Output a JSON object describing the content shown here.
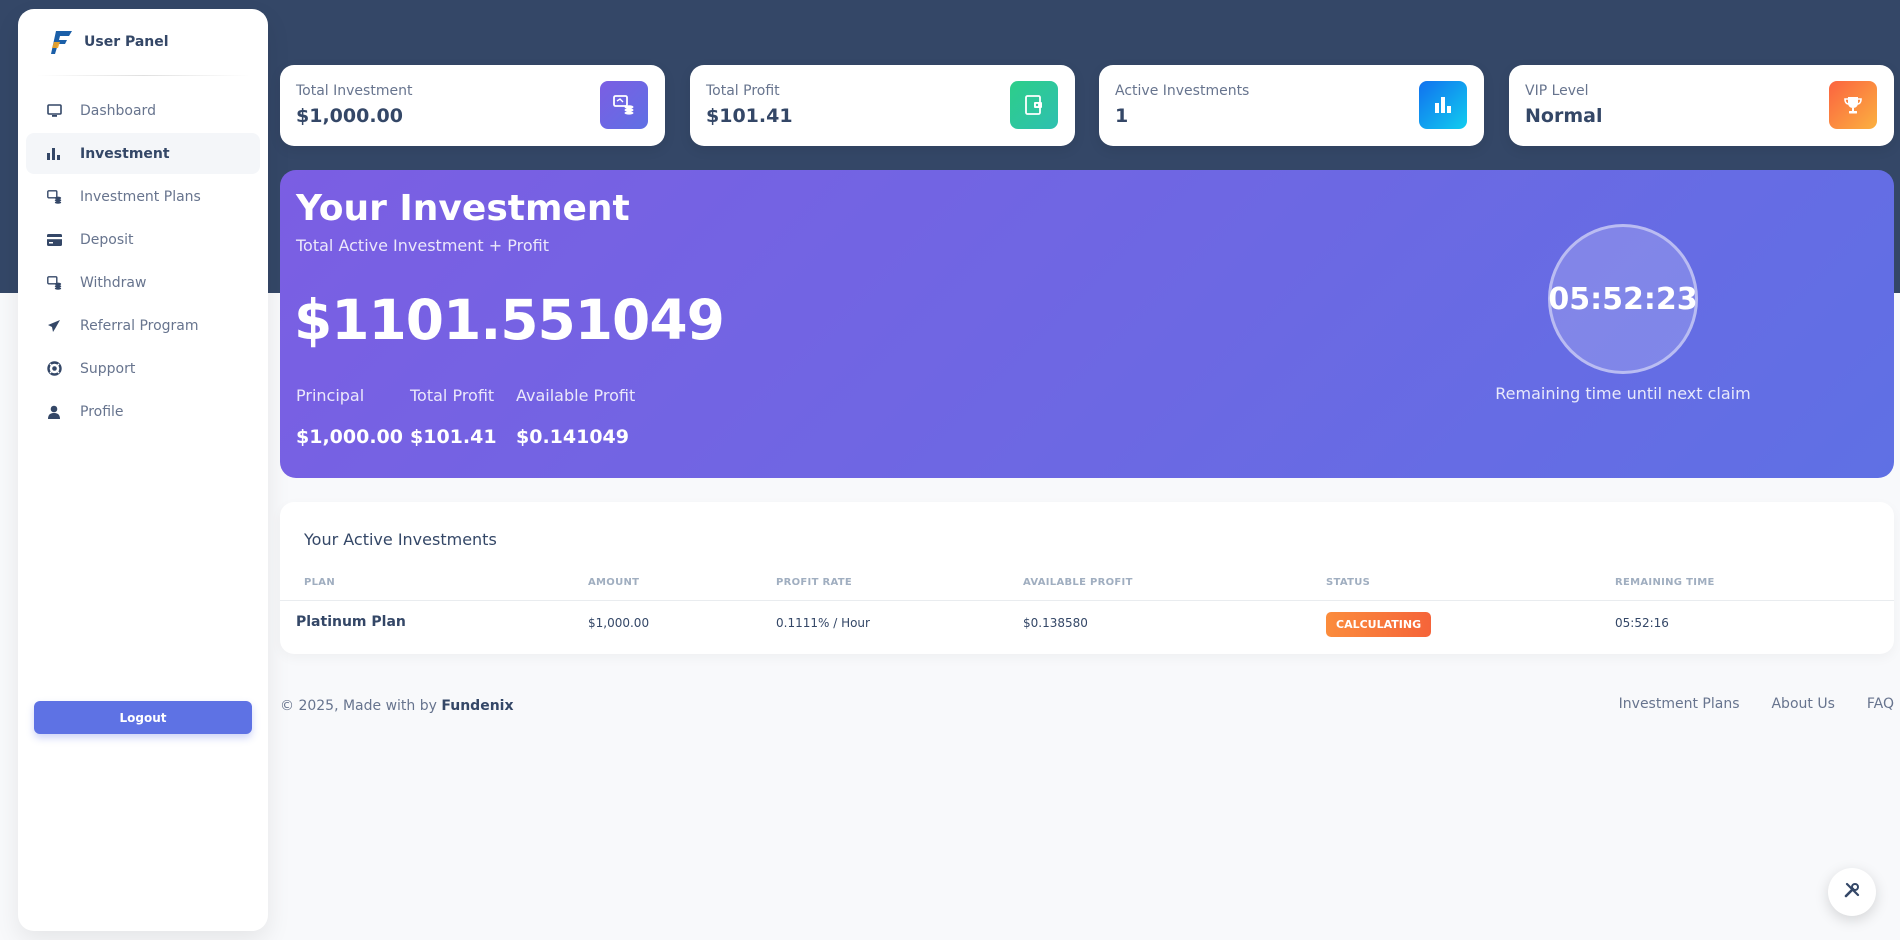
{
  "brand": {
    "name": "User Panel"
  },
  "sidebar": {
    "items": [
      {
        "label": "Dashboard",
        "icon": "monitor-icon"
      },
      {
        "label": "Investment",
        "icon": "bar-chart-icon",
        "active": true
      },
      {
        "label": "Investment Plans",
        "icon": "coins-icon"
      },
      {
        "label": "Deposit",
        "icon": "credit-card-icon"
      },
      {
        "label": "Withdraw",
        "icon": "coins-icon"
      },
      {
        "label": "Referral Program",
        "icon": "paper-plane-icon"
      },
      {
        "label": "Support",
        "icon": "lifebuoy-icon"
      },
      {
        "label": "Profile",
        "icon": "user-icon"
      }
    ],
    "logout_label": "Logout"
  },
  "stats": [
    {
      "label": "Total Investment",
      "value": "$1,000.00",
      "icon": "coins-icon",
      "color": "#6a5ce0"
    },
    {
      "label": "Total Profit",
      "value": "$101.41",
      "icon": "wallet-icon",
      "color": "#2ec7a1"
    },
    {
      "label": "Active Investments",
      "value": "1",
      "icon": "bar-chart-icon",
      "color": "#1a9cf2"
    },
    {
      "label": "VIP Level",
      "value": "Normal",
      "icon": "trophy-icon",
      "color": "#fb8c3c"
    }
  ],
  "hero": {
    "title": "Your Investment",
    "subtitle": "Total Active Investment + Profit",
    "total": "$1101.551049",
    "principal_label": "Principal",
    "principal_value": "$1,000.00",
    "profit_label": "Total Profit",
    "profit_value": "$101.41",
    "available_label": "Available Profit",
    "available_value": "$0.141049",
    "timer": "05:52:23",
    "timer_caption": "Remaining time until next claim"
  },
  "investments": {
    "title": "Your Active Investments",
    "columns": [
      "PLAN",
      "AMOUNT",
      "PROFIT RATE",
      "AVAILABLE PROFIT",
      "STATUS",
      "REMAINING TIME"
    ],
    "rows": [
      {
        "plan": "Platinum Plan",
        "amount": "$1,000.00",
        "rate": "0.1111% / Hour",
        "available": "$0.138580",
        "status": "CALCULATING",
        "remaining": "05:52:16"
      }
    ]
  },
  "footer": {
    "copyright": "© 2025, Made with by",
    "brand": "Fundenix",
    "links": [
      "Investment Plans",
      "About Us",
      "FAQ"
    ]
  }
}
